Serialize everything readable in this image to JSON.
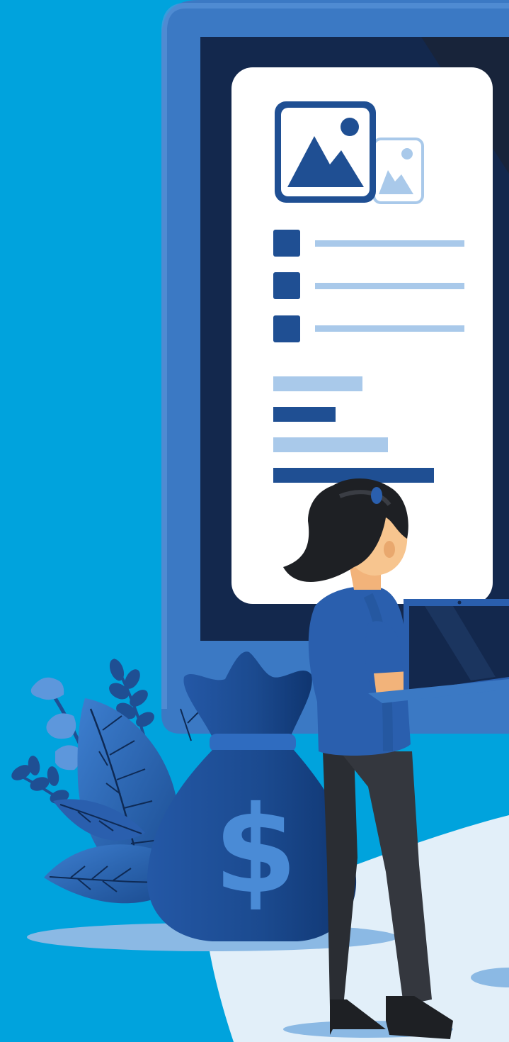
{
  "illustration": {
    "money_bag_symbol": "$",
    "icons": {
      "monitor": "monitor-icon",
      "image_placeholder": "image-icon",
      "money_bag": "money-bag-icon",
      "laptop": "laptop-icon",
      "plant": "plant-icon",
      "person": "person-icon"
    }
  },
  "content_card": {
    "list_items": 3,
    "text_blocks": 4
  },
  "colors": {
    "background": "#00a3dd",
    "monitor_frame": "#3b79c4",
    "monitor_screen": "#13284d",
    "card": "#ffffff",
    "primary": "#1f4f93",
    "line_light": "#a9c9ea",
    "floor": "#e2eff9",
    "shadow": "#8bb9e4"
  }
}
